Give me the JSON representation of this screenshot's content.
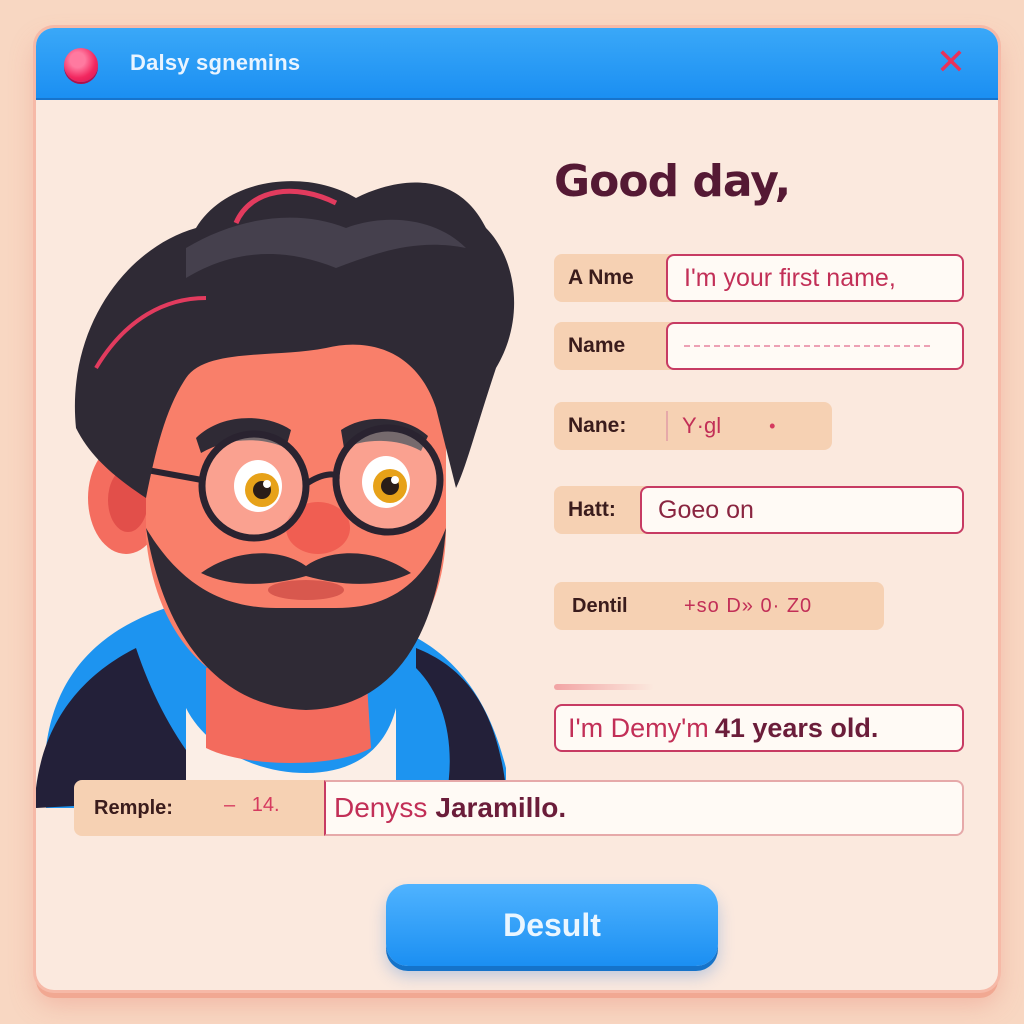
{
  "window": {
    "title": "Dalsy sgnemins",
    "close_symbol": "✕"
  },
  "greeting": "Good day,",
  "form": {
    "first_name": {
      "label": "A Nme",
      "value": "I'm your first name,"
    },
    "name": {
      "label": "Name",
      "value": ""
    },
    "nane": {
      "label": "Nane:",
      "value": "Y·gl",
      "marker": "•"
    },
    "hatt": {
      "label": "Hatt:",
      "value": "Goeo on"
    },
    "dentil": {
      "label": "Dentil",
      "value": "+so D» 0· Z0"
    }
  },
  "statement": {
    "prefix": "I'm Demy'm",
    "bold": "41 years old."
  },
  "remple": {
    "label": "Remple:",
    "dash": "–",
    "number": "14.",
    "value_prefix": "Denyss",
    "value_bold": "Jaramillo."
  },
  "result_button": "Desult",
  "icons": {
    "window": "red-circle-icon",
    "close": "close-icon"
  },
  "colors": {
    "titlebar": "#1b8ff2",
    "accent": "#c73b63",
    "button": "#1b8ff2",
    "panel": "#fbe9de"
  }
}
